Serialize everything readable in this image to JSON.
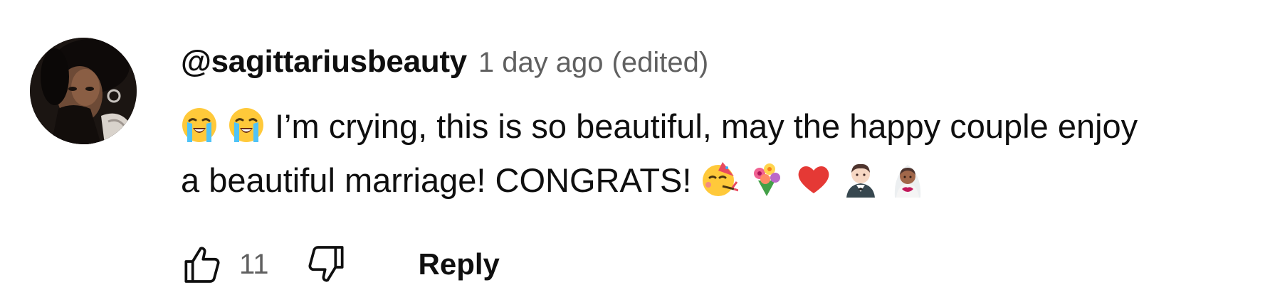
{
  "comment": {
    "author": "@sagittariusbeauty",
    "timestamp": "1 day ago",
    "edited_label": "(edited)",
    "body_line1_text": "I’m crying, this is so beautiful, may the happy couple enjoy",
    "body_line2_text": "a beautiful marriage! CONGRATS!",
    "emoji": {
      "line1": [
        "loudly-crying-face",
        "loudly-crying-face"
      ],
      "line2": [
        "partying-face",
        "bouquet",
        "red-heart",
        "person-in-tuxedo",
        "person-with-veil"
      ]
    }
  },
  "actions": {
    "like_icon": "thumbs-up-icon",
    "like_count": "11",
    "dislike_icon": "thumbs-down-icon",
    "reply_label": "Reply"
  },
  "colors": {
    "text_primary": "#0f0f0f",
    "text_secondary": "#606060",
    "background": "#ffffff"
  }
}
